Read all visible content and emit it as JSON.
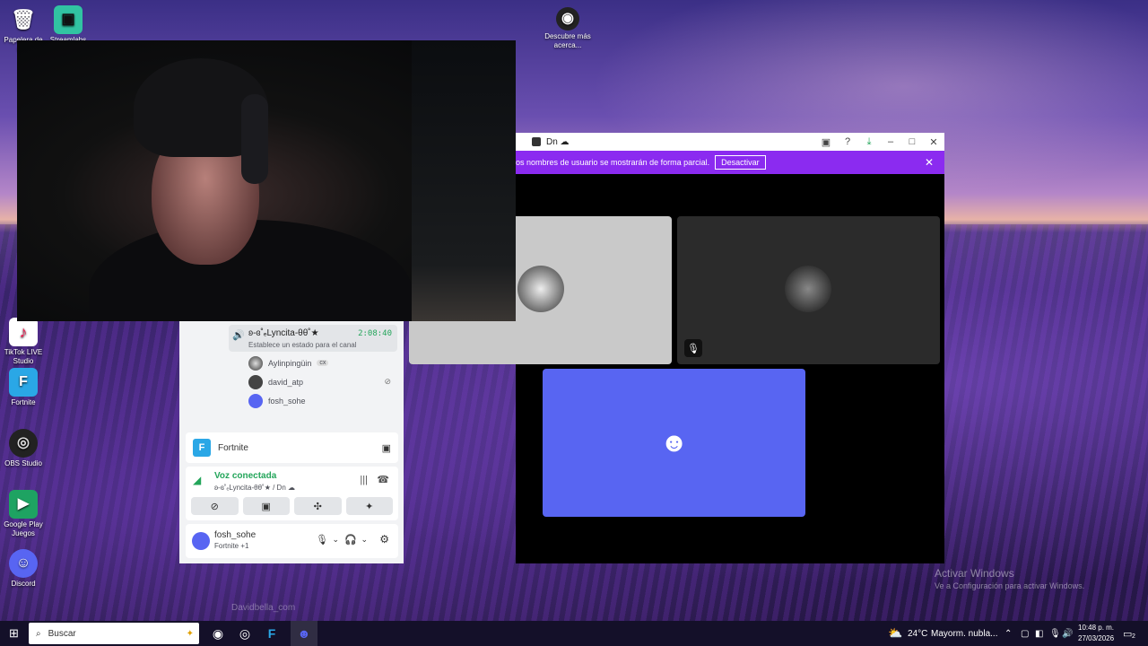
{
  "desktop": {
    "icons": [
      {
        "label": "Papelera de re...",
        "icon": "recycle-bin-icon"
      },
      {
        "label": "Streamlabs",
        "icon": "streamlabs-icon"
      },
      {
        "label": "Descubre más acerca...",
        "icon": "discover-icon"
      },
      {
        "label": "TikTok LIVE Studio",
        "icon": "tiktok-icon"
      },
      {
        "label": "Fortnite",
        "icon": "fortnite-icon"
      },
      {
        "label": "OBS Studio",
        "icon": "obs-icon"
      },
      {
        "label": "Google Play Juegos",
        "icon": "google-play-icon"
      },
      {
        "label": "Discord",
        "icon": "discord-icon"
      }
    ],
    "watermark": "Davidbella_com",
    "activate_title": "Activar Windows",
    "activate_sub": "Ve a Configuración para activar Windows."
  },
  "discord_window": {
    "title": "Dn ☁",
    "banner_text": "os nombres de usuario se mostrarán de forma parcial.",
    "banner_button": "Desactivar"
  },
  "voice_panel": {
    "channel_user": "ʚ-ɞ˚ₑLyncita-θθ˚★",
    "channel_time": "2:08:40",
    "status_hint": "Establece un estado para el canal",
    "members": [
      {
        "name": "Aylinpingüin",
        "badge": "cx"
      },
      {
        "name": "david_atp",
        "badge": ""
      },
      {
        "name": "fosh_sohe",
        "badge": ""
      }
    ],
    "activity": "Fortnite",
    "connection_label": "Voz conectada",
    "connection_sub": "ʚ-ɞ˚ₑLyncita-θθ˚★ / Dn ☁",
    "user_name": "fosh_sohe",
    "user_activity": "Fortnite +1"
  },
  "taskbar": {
    "search_placeholder": "Buscar",
    "weather_temp": "24°C",
    "weather_text": "Mayorm. nubla...",
    "time": "10:48 p. m.",
    "date": "27/03/2026",
    "notif_count": "2"
  },
  "colors": {
    "discord_blurple": "#5865f2",
    "banner_purple": "#8b2bf0",
    "voice_green": "#23a55a"
  }
}
